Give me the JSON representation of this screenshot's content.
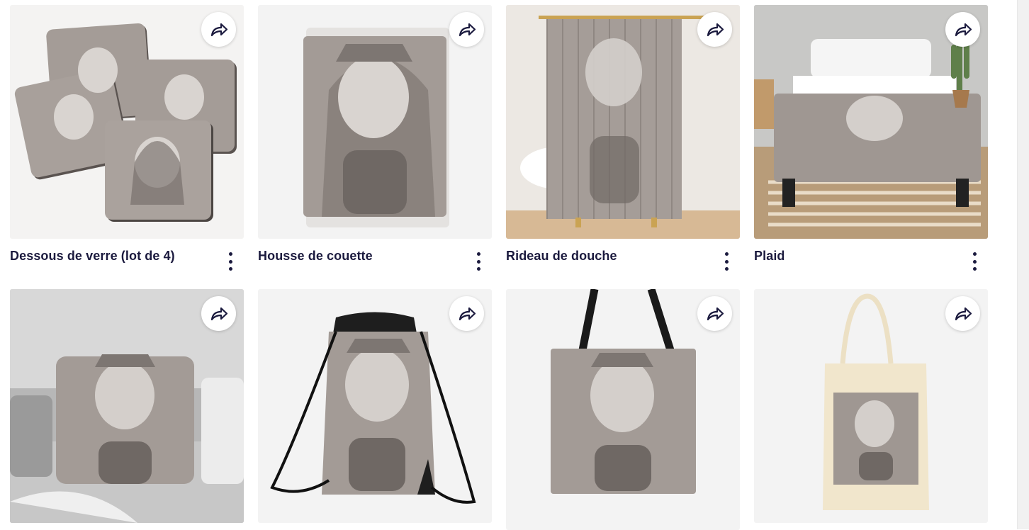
{
  "products": [
    {
      "title": "Dessous de verre (lot de 4)",
      "share_icon": "share-arrow-icon",
      "menu_icon": "more-vertical-icon"
    },
    {
      "title": "Housse de couette",
      "share_icon": "share-arrow-icon",
      "menu_icon": "more-vertical-icon"
    },
    {
      "title": "Rideau de douche",
      "share_icon": "share-arrow-icon",
      "menu_icon": "more-vertical-icon"
    },
    {
      "title": "Plaid",
      "share_icon": "share-arrow-icon",
      "menu_icon": "more-vertical-icon"
    },
    {
      "title": "",
      "share_icon": "share-arrow-icon"
    },
    {
      "title": "",
      "share_icon": "share-arrow-icon"
    },
    {
      "title": "",
      "share_icon": "share-arrow-icon"
    },
    {
      "title": "",
      "share_icon": "share-arrow-icon"
    }
  ],
  "colors": {
    "title_text": "#1b1a3e",
    "artwork_gray": "#9d9590",
    "card_bg": "#f2f2f2"
  }
}
